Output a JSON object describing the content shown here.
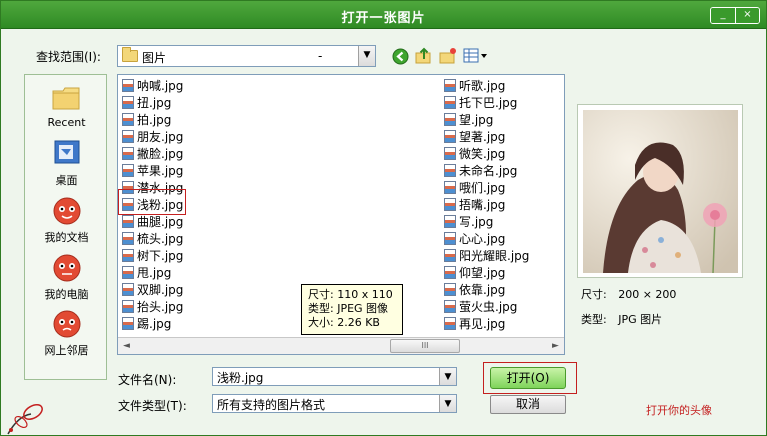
{
  "dialog": {
    "title": "打开一张图片",
    "minimize_label": "_",
    "close_label": "×"
  },
  "look_in": {
    "label": "查找范围(I):",
    "value": "图片",
    "dash": "-"
  },
  "places": [
    {
      "label": "Recent",
      "icon": "recent-folder-icon"
    },
    {
      "label": "桌面",
      "icon": "desktop-icon"
    },
    {
      "label": "我的文档",
      "icon": "my-documents-icon"
    },
    {
      "label": "我的电脑",
      "icon": "my-computer-icon"
    },
    {
      "label": "网上邻居",
      "icon": "network-places-icon"
    }
  ],
  "files_left": [
    "呐喊.jpg",
    "扭.jpg",
    "拍.jpg",
    "朋友.jpg",
    "撇脸.jpg",
    "苹果.jpg",
    "潜水.jpg",
    "浅粉.jpg",
    "曲腿.jpg",
    "梳头.jpg",
    "树下.jpg",
    "甩.jpg",
    "双脚.jpg",
    "抬头.jpg",
    "踢.jpg"
  ],
  "files_right": [
    "听歌.jpg",
    "托下巴.jpg",
    "望.jpg",
    "望著.jpg",
    "微笑.jpg",
    "未命名.jpg",
    "哦们.jpg",
    "捂嘴.jpg",
    "写.jpg",
    "心心.jpg",
    "阳光耀眼.jpg",
    "仰望.jpg",
    "依靠.jpg",
    "萤火虫.jpg",
    "再见.jpg"
  ],
  "tooltip": {
    "line1": "尺寸: 110 x 110",
    "line2": "类型: JPEG 图像",
    "line3": "大小: 2.26 KB"
  },
  "scrollbar": {
    "left_arrow": "◄",
    "thumb": "III",
    "right_arrow": "►"
  },
  "preview": {
    "size_label": "尺寸:",
    "size_value": "200 × 200",
    "type_label": "类型:",
    "type_value": "JPG 图片"
  },
  "filename": {
    "label": "文件名(N):",
    "value": "浅粉.jpg"
  },
  "filetype": {
    "label": "文件类型(T):",
    "value": "所有支持的图片格式"
  },
  "buttons": {
    "open": "打开(O)",
    "cancel": "取消"
  },
  "hint": "打开你的头像",
  "colors": {
    "title_bar": "#2f8a24",
    "highlight": "#c41f1f",
    "open_button": "#7fd45a"
  }
}
